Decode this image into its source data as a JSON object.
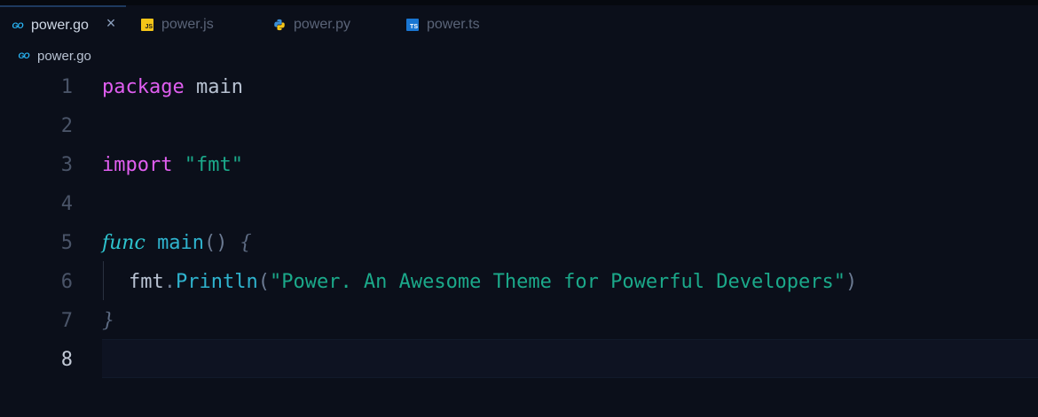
{
  "tabs": [
    {
      "label": "power.go",
      "icon": "go-icon",
      "active": true
    },
    {
      "label": "power.js",
      "icon": "js-icon"
    },
    {
      "label": "power.py",
      "icon": "python-icon"
    },
    {
      "label": "power.ts",
      "icon": "ts-icon"
    }
  ],
  "icons": {
    "go": "GO",
    "js": "JS",
    "ts": "TS"
  },
  "close_glyph": "×",
  "breadcrumb": {
    "label": "power.go"
  },
  "editor": {
    "line_numbers": [
      "1",
      "2",
      "3",
      "4",
      "5",
      "6",
      "7",
      "8"
    ],
    "tokens": {
      "package_kw": "package",
      "package_name": "main",
      "import_kw": "import",
      "import_path": "\"fmt\"",
      "func_kw": "func",
      "func_name": "main",
      "parens": "()",
      "open_brace": "{",
      "pkg_ref": "fmt",
      "dot": ".",
      "call_name": "Println",
      "open_paren": "(",
      "call_arg": "\"Power. An Awesome Theme for Powerful Developers\"",
      "close_paren": ")",
      "close_brace": "}"
    }
  },
  "colors": {
    "background": "#0b0f1a",
    "keyword": "#e05ef0",
    "string": "#1ba98a",
    "function": "#2fb3ce",
    "identifier": "#b8c2d2"
  }
}
